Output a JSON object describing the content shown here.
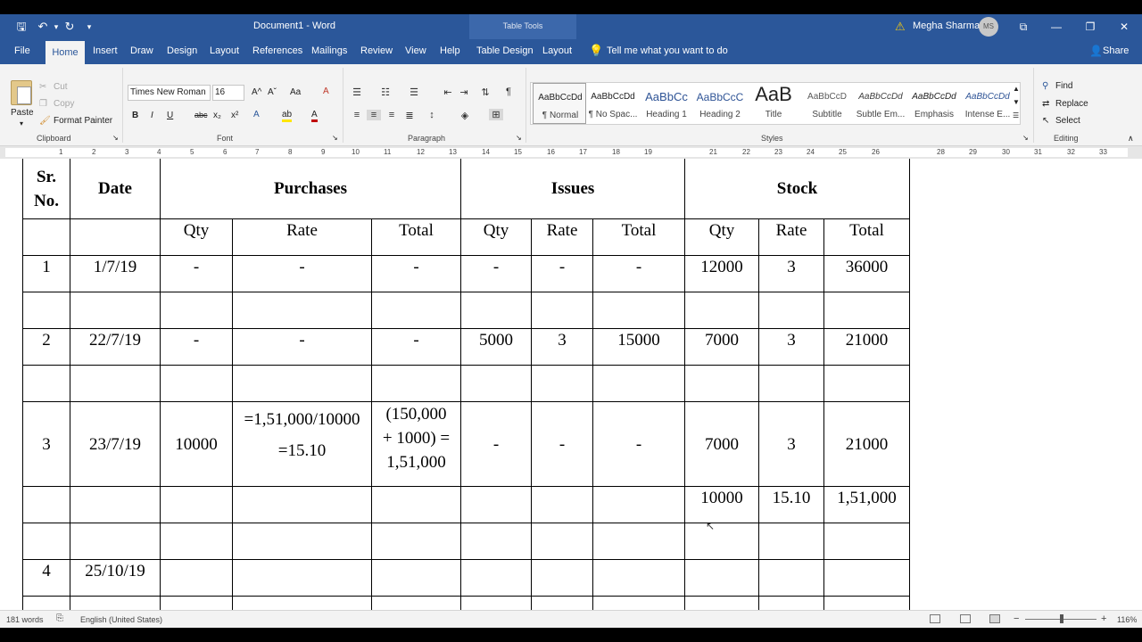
{
  "titlebar": {
    "title": "Document1 - Word",
    "context": "Table Tools",
    "user_name": "Megha Sharma",
    "user_initials": "MS",
    "qa_save": "🖫",
    "qa_undo": "↶",
    "qa_undo_more": "▾",
    "qa_redo": "↻",
    "qa_customize": "▾",
    "warning": "⚠",
    "ribbon_display": "⧉",
    "minimize": "—",
    "restore": "❐",
    "close": "✕"
  },
  "tabs": [
    "File",
    "Home",
    "Insert",
    "Draw",
    "Design",
    "Layout",
    "References",
    "Mailings",
    "Review",
    "View",
    "Help",
    "Table Design",
    "Layout"
  ],
  "tell_me": "Tell me what you want to do",
  "share": "Share",
  "ribbon": {
    "clipboard": {
      "paste": "Paste",
      "cut": "Cut",
      "copy": "Copy",
      "format_painter": "Format Painter",
      "label": "Clipboard"
    },
    "font": {
      "name": "Times New Roman",
      "size": "16",
      "label": "Font",
      "buttons": [
        "B",
        "I",
        "U",
        "abc",
        "x₂",
        "x²"
      ],
      "grow": "A^",
      "shrink": "Aˇ",
      "case": "Aa",
      "clear": "A",
      "effects": "A",
      "highlight": "ab",
      "color": "A"
    },
    "paragraph": {
      "label": "Paragraph",
      "show_marks": "¶"
    },
    "styles": {
      "label": "Styles",
      "items": [
        {
          "sample": "AaBbCcDd",
          "name": "¶ Normal"
        },
        {
          "sample": "AaBbCcDd",
          "name": "¶ No Spac..."
        },
        {
          "sample": "AaBbCc",
          "name": "Heading 1"
        },
        {
          "sample": "AaBbCcC",
          "name": "Heading 2"
        },
        {
          "sample": "AaB",
          "name": "Title"
        },
        {
          "sample": "AaBbCcD",
          "name": "Subtitle"
        },
        {
          "sample": "AaBbCcDd",
          "name": "Subtle Em..."
        },
        {
          "sample": "AaBbCcDd",
          "name": "Emphasis"
        },
        {
          "sample": "AaBbCcDd",
          "name": "Intense E..."
        }
      ]
    },
    "editing": {
      "find": "Find",
      "replace": "Replace",
      "select": "Select",
      "label": "Editing"
    }
  },
  "ruler": [
    "1",
    "2",
    "3",
    "4",
    "5",
    "6",
    "7",
    "8",
    "9",
    "10",
    "11",
    "12",
    "13",
    "14",
    "15",
    "16",
    "17",
    "18",
    "19",
    "21",
    "22",
    "23",
    "24",
    "25",
    "26",
    "28",
    "29",
    "30",
    "31",
    "32",
    "33"
  ],
  "table": {
    "headers": {
      "sr_no": [
        "Sr.",
        "No."
      ],
      "date": "Date",
      "purchases": "Purchases",
      "issues": "Issues",
      "stock": "Stock"
    },
    "subheaders": [
      "Qty",
      "Rate",
      "Total",
      "Qty",
      "Rate",
      "Total",
      "Qty",
      "Rate",
      "Total"
    ],
    "row1": [
      "1",
      "1/7/19",
      "-",
      "-",
      "-",
      "-",
      "-",
      "-",
      "12000",
      "3",
      "36000"
    ],
    "row2": [
      "2",
      "22/7/19",
      "-",
      "-",
      "-",
      "5000",
      "3",
      "15000",
      "7000",
      "3",
      "21000"
    ],
    "row3": {
      "sr": "3",
      "date": "23/7/19",
      "p_qty": "10000",
      "p_rate": [
        "=1,51,000/10000",
        "=15.10"
      ],
      "p_total": [
        "(150,000",
        "+ 1000) =",
        "1,51,000"
      ],
      "i_qty": "-",
      "i_rate": "-",
      "i_total": "-",
      "s_qty": "7000",
      "s_rate": "3",
      "s_total": "21000"
    },
    "row3b": {
      "s_qty": "10000",
      "s_rate": "15.10",
      "s_total": "1,51,000"
    },
    "row4": {
      "sr": "4",
      "date": "25/10/19"
    }
  },
  "status": {
    "words": "181 words",
    "language": "English (United States)",
    "zoom": "116%",
    "zoom_minus": "−",
    "zoom_plus": "+"
  }
}
